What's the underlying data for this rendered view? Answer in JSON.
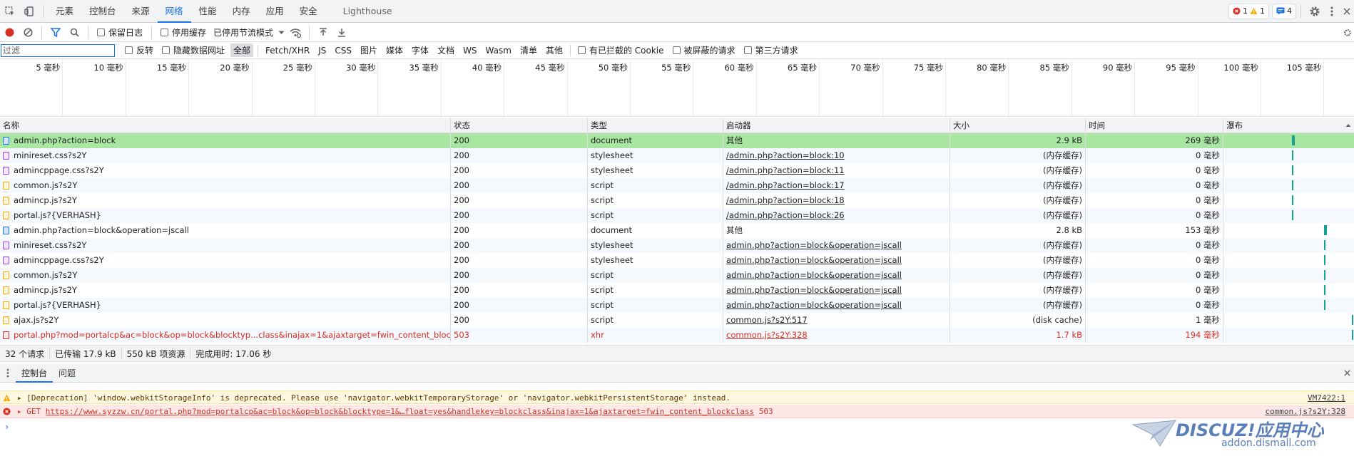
{
  "devtools_tabs": [
    "元素",
    "控制台",
    "来源",
    "网络",
    "性能",
    "内存",
    "应用",
    "安全",
    "Lighthouse"
  ],
  "devtools_active_tab": "网络",
  "badges": {
    "errors": "1",
    "warnings": "1",
    "messages": "4"
  },
  "toolbar": {
    "preserve_log": "保留日志",
    "disable_cache": "停用缓存",
    "throttle": "已停用节流模式"
  },
  "filter": {
    "placeholder": "过滤",
    "invert": "反转",
    "hide_data_urls": "隐藏数据网址",
    "types": [
      "全部",
      "Fetch/XHR",
      "JS",
      "CSS",
      "图片",
      "媒体",
      "字体",
      "文档",
      "WS",
      "Wasm",
      "清单",
      "其他"
    ],
    "blocked_cookies": "有已拦截的 Cookie",
    "blocked_requests": "被屏蔽的请求",
    "third_party": "第三方请求"
  },
  "timeline_ticks": [
    "5 毫秒",
    "10 毫秒",
    "15 毫秒",
    "20 毫秒",
    "25 毫秒",
    "30 毫秒",
    "35 毫秒",
    "40 毫秒",
    "45 毫秒",
    "50 毫秒",
    "55 毫秒",
    "60 毫秒",
    "65 毫秒",
    "70 毫秒",
    "75 毫秒",
    "80 毫秒",
    "85 毫秒",
    "90 毫秒",
    "95 毫秒",
    "100 毫秒",
    "105 毫秒"
  ],
  "columns": {
    "name": "名称",
    "status": "状态",
    "type": "类型",
    "initiator": "启动器",
    "size": "大小",
    "time": "时间",
    "waterfall": "瀑布"
  },
  "requests": [
    {
      "name": "admin.php?action=block",
      "status": "200",
      "type": "document",
      "initiator": "其他",
      "initiator_link": false,
      "size": "2.9 kB",
      "time": "269 毫秒",
      "kind": "doc",
      "selected": true,
      "error": false
    },
    {
      "name": "minireset.css?s2Y",
      "status": "200",
      "type": "stylesheet",
      "initiator": "/admin.php?action=block:10",
      "initiator_link": true,
      "size": "(内存缓存)",
      "time": "0 毫秒",
      "kind": "css",
      "selected": false,
      "error": false
    },
    {
      "name": "admincppage.css?s2Y",
      "status": "200",
      "type": "stylesheet",
      "initiator": "/admin.php?action=block:11",
      "initiator_link": true,
      "size": "(内存缓存)",
      "time": "0 毫秒",
      "kind": "css",
      "selected": false,
      "error": false
    },
    {
      "name": "common.js?s2Y",
      "status": "200",
      "type": "script",
      "initiator": "/admin.php?action=block:17",
      "initiator_link": true,
      "size": "(内存缓存)",
      "time": "0 毫秒",
      "kind": "js",
      "selected": false,
      "error": false
    },
    {
      "name": "admincp.js?s2Y",
      "status": "200",
      "type": "script",
      "initiator": "/admin.php?action=block:18",
      "initiator_link": true,
      "size": "(内存缓存)",
      "time": "0 毫秒",
      "kind": "js",
      "selected": false,
      "error": false
    },
    {
      "name": "portal.js?{VERHASH}",
      "status": "200",
      "type": "script",
      "initiator": "/admin.php?action=block:26",
      "initiator_link": true,
      "size": "(内存缓存)",
      "time": "0 毫秒",
      "kind": "js",
      "selected": false,
      "error": false
    },
    {
      "name": "admin.php?action=block&operation=jscall",
      "status": "200",
      "type": "document",
      "initiator": "其他",
      "initiator_link": false,
      "size": "2.8 kB",
      "time": "153 毫秒",
      "kind": "doc",
      "selected": false,
      "error": false
    },
    {
      "name": "minireset.css?s2Y",
      "status": "200",
      "type": "stylesheet",
      "initiator": "admin.php?action=block&operation=jscall",
      "initiator_link": true,
      "size": "(内存缓存)",
      "time": "0 毫秒",
      "kind": "css",
      "selected": false,
      "error": false
    },
    {
      "name": "admincppage.css?s2Y",
      "status": "200",
      "type": "stylesheet",
      "initiator": "admin.php?action=block&operation=jscall",
      "initiator_link": true,
      "size": "(内存缓存)",
      "time": "0 毫秒",
      "kind": "css",
      "selected": false,
      "error": false
    },
    {
      "name": "common.js?s2Y",
      "status": "200",
      "type": "script",
      "initiator": "admin.php?action=block&operation=jscall",
      "initiator_link": true,
      "size": "(内存缓存)",
      "time": "0 毫秒",
      "kind": "js",
      "selected": false,
      "error": false
    },
    {
      "name": "admincp.js?s2Y",
      "status": "200",
      "type": "script",
      "initiator": "admin.php?action=block&operation=jscall",
      "initiator_link": true,
      "size": "(内存缓存)",
      "time": "0 毫秒",
      "kind": "js",
      "selected": false,
      "error": false
    },
    {
      "name": "portal.js?{VERHASH}",
      "status": "200",
      "type": "script",
      "initiator": "admin.php?action=block&operation=jscall",
      "initiator_link": true,
      "size": "(内存缓存)",
      "time": "0 毫秒",
      "kind": "js",
      "selected": false,
      "error": false
    },
    {
      "name": "ajax.js?s2Y",
      "status": "200",
      "type": "script",
      "initiator": "common.js?s2Y:517",
      "initiator_link": true,
      "size": "(disk cache)",
      "time": "1 毫秒",
      "kind": "js",
      "selected": false,
      "error": false
    },
    {
      "name": "portal.php?mod=portalcp&ac=block&op=block&blocktyp...class&inajax=1&ajaxtarget=fwin_content_blockclass",
      "status": "503",
      "type": "xhr",
      "initiator": "common.js?s2Y:328",
      "initiator_link": true,
      "size": "1.7 kB",
      "time": "194 毫秒",
      "kind": "xhr",
      "selected": false,
      "error": true
    }
  ],
  "summary": [
    "32 个请求",
    "已传输 17.9 kB",
    "550 kB 项资源",
    "完成用时: 17.06 秒"
  ],
  "drawer_tabs": [
    "控制台",
    "问题"
  ],
  "console": [
    {
      "level": "warn",
      "text": "[Deprecation] 'window.webkitStorageInfo' is deprecated. Please use 'navigator.webkitTemporaryStorage' or 'navigator.webkitPersistentStorage' instead.",
      "source": "VM7422:1"
    },
    {
      "level": "error",
      "method": "GET",
      "url": "https://www.syzzw.cn/portal.php?mod=portalcp&ac=block&op=block&blocktype=1&…float=yes&handlekey=blockclass&inajax=1&ajaxtarget=fwin_content_blockclass",
      "code": "503",
      "source": "common.js?s2Y:328"
    }
  ],
  "watermark": {
    "brand": "DISCUZ!应用中心",
    "url": "addon.dismall.com"
  },
  "colors": {
    "accent": "#1a73e8",
    "selected_row": "#a8e6a1",
    "waterfall": "#13a38f",
    "error": "#d93025"
  }
}
